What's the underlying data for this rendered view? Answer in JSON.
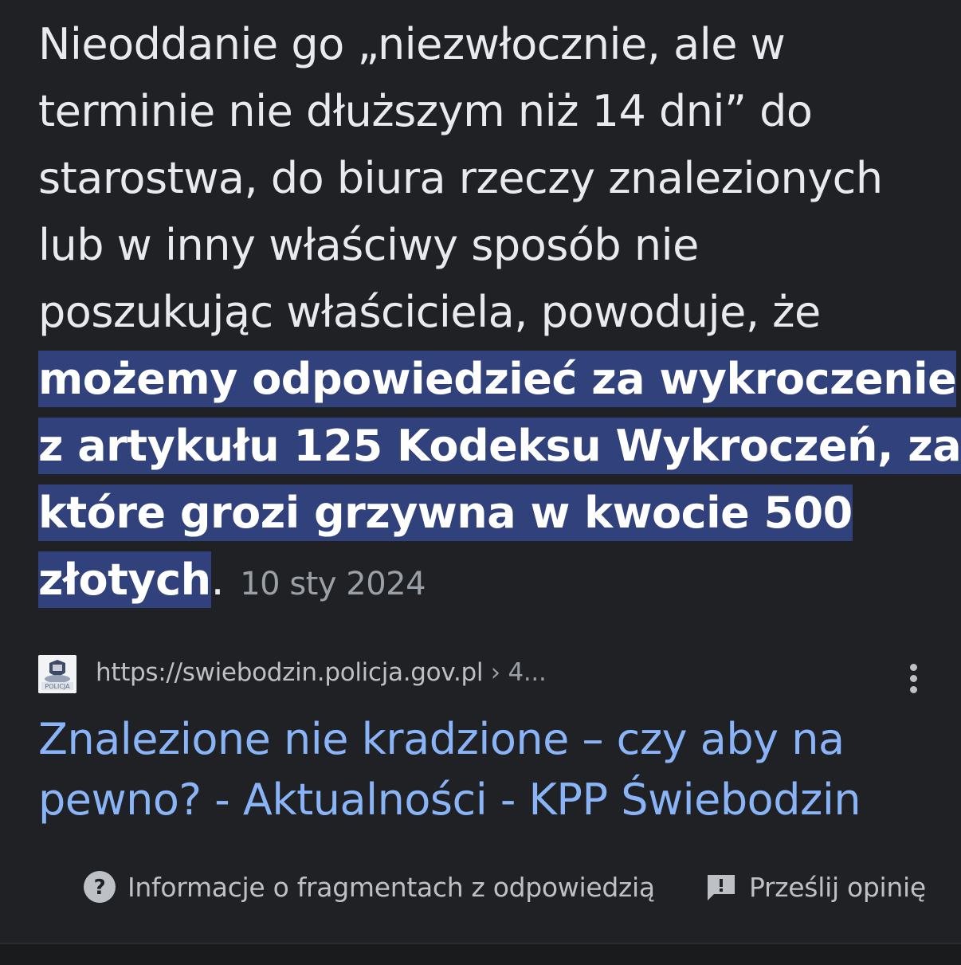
{
  "snippet": {
    "lines_plain": [
      "Nieoddanie go „niezwłocznie, ale w",
      "terminie nie dłuższym niż 14 dni” do",
      "starostwa, do biura rzeczy znalezionych",
      "lub w inny właściwy sposób nie",
      "poszukując właściciela, powoduje, że"
    ],
    "lines_highlight": [
      "możemy odpowiedzieć za wykroczenie",
      "z artykułu 125 Kodeksu Wykroczeń, za",
      "które grozi grzywna w kwocie 500",
      "złotych"
    ],
    "trailing_period": ".",
    "date": "10 sty 2024"
  },
  "source": {
    "favicon_icon": "policja-logo-icon",
    "url": "https://swiebodzin.policja.gov.pl",
    "crumb": " › 4...",
    "more_icon": "more-vert-icon"
  },
  "result_title": {
    "line1": "Znalezione nie kradzione – czy aby na",
    "line2": "pewno? - Aktualności - KPP Świebodzin"
  },
  "footer": {
    "info_icon": "help-circle-icon",
    "info_label": "Informacje o fragmentach z odpowiedzią",
    "feedback_icon": "feedback-icon",
    "feedback_label": "Prześlij opinię"
  },
  "colors": {
    "background": "#202124",
    "highlight": "#30417b",
    "link": "#8ab4f8"
  }
}
